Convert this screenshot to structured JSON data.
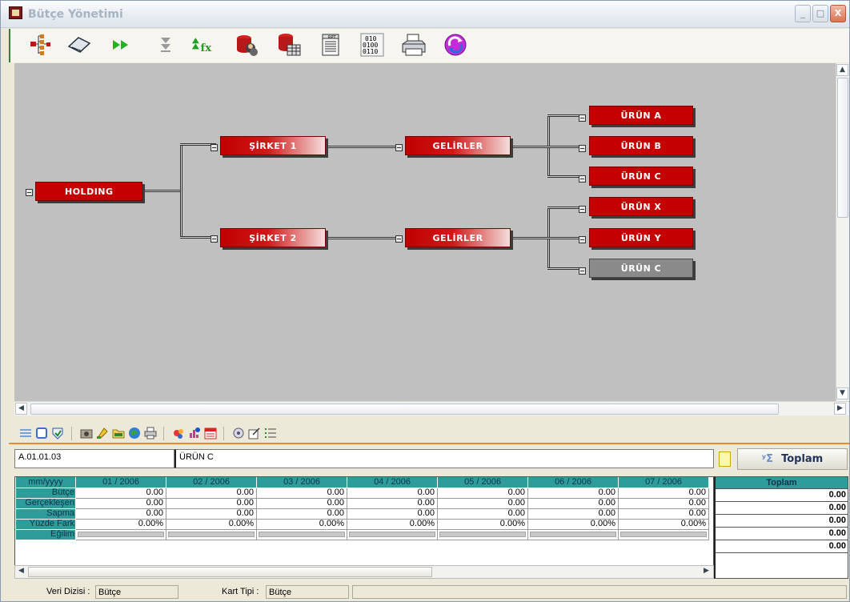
{
  "window": {
    "title": "Bütçe Yönetimi",
    "controls": [
      "_",
      "□",
      "X"
    ]
  },
  "toolbar": {
    "items": [
      {
        "name": "tree-icon"
      },
      {
        "name": "eraser-icon"
      },
      {
        "name": "fast-forward-icon"
      },
      {
        "name": "arrow-down-icon"
      },
      {
        "name": "formula-icon"
      },
      {
        "name": "database-users-icon"
      },
      {
        "name": "database-table-icon"
      },
      {
        "name": "report-icon",
        "label": "RPT"
      },
      {
        "name": "binary-icon",
        "label": "010\n0100\n0110"
      },
      {
        "name": "printer-icon"
      },
      {
        "name": "refresh-icon"
      }
    ]
  },
  "diagram": {
    "nodes": {
      "holding": "HOLDING",
      "sirket1": "ŞİRKET 1",
      "sirket2": "ŞİRKET 2",
      "gelirler1": "GELİRLER",
      "gelirler2": "GELİRLER",
      "urun_a": "ÜRÜN A",
      "urun_b": "ÜRÜN B",
      "urun_c1": "ÜRÜN C",
      "urun_x": "ÜRÜN X",
      "urun_y": "ÜRÜN Y",
      "urun_c2": "ÜRÜN C"
    },
    "colors": {
      "canvas": "#c0c0c0",
      "node": "#c40000",
      "selected_node": "#8a8a8a"
    }
  },
  "detail": {
    "code": "A.01.01.03",
    "name": "ÜRÜN C",
    "toplam_button": "Toplam",
    "toplam_icon": "ʸΣ"
  },
  "grid": {
    "corner": "mm/yyyy",
    "columns": [
      "01 / 2006",
      "02 / 2006",
      "03 / 2006",
      "04 / 2006",
      "05 / 2006",
      "06 / 2006",
      "07 / 2006"
    ],
    "rows": [
      {
        "label": "Bütçe",
        "values": [
          "0.00",
          "0.00",
          "0.00",
          "0.00",
          "0.00",
          "0.00",
          "0.00"
        ]
      },
      {
        "label": "Gerçekleşen",
        "values": [
          "0.00",
          "0.00",
          "0.00",
          "0.00",
          "0.00",
          "0.00",
          "0.00"
        ]
      },
      {
        "label": "Sapma",
        "values": [
          "0.00",
          "0.00",
          "0.00",
          "0.00",
          "0.00",
          "0.00",
          "0.00"
        ]
      },
      {
        "label": "Yüzde Fark",
        "values": [
          "0.00%",
          "0.00%",
          "0.00%",
          "0.00%",
          "0.00%",
          "0.00%",
          "0.00%"
        ]
      },
      {
        "label": "Eğilim",
        "values": []
      }
    ],
    "header_color": "#2e9d9a"
  },
  "totals": {
    "header": "Toplam",
    "values": [
      "0.00",
      "0.00",
      "0.00",
      "0.00",
      "0.00"
    ]
  },
  "status": {
    "veri_dizisi_label": "Veri Dizisi :",
    "veri_dizisi_value": "Bütçe",
    "kart_tipi_label": "Kart Tipi :",
    "kart_tipi_value": "Bütçe"
  }
}
